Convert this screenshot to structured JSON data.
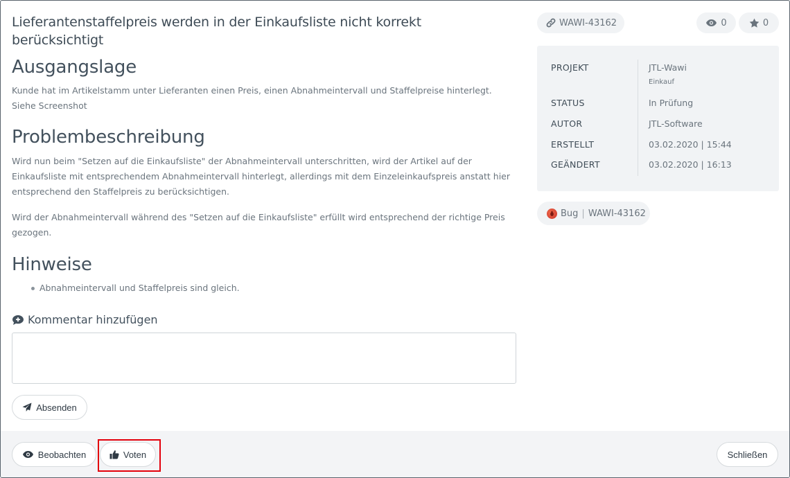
{
  "issue": {
    "title": "Lieferantenstaffelpreis werden in der Einkaufsliste nicht korrekt berücksichtigt",
    "sections": {
      "ausgangslage": {
        "heading": "Ausgangslage",
        "text": "Kunde hat im Artikelstamm unter Lieferanten einen Preis, einen Abnahmeintervall und Staffelpreise hinterlegt. Siehe Screenshot"
      },
      "problembeschreibung": {
        "heading": "Problembeschreibung",
        "paragraphs": [
          "Wird nun beim \"Setzen auf die Einkaufsliste\" der Abnahmeintervall unterschritten, wird der Artikel auf der Einkaufsliste mit entsprechendem Abnahmeintervall hinterlegt, allerdings mit dem Einzeleinkaufspreis anstatt hier entsprechend den Staffelpreis zu berücksichtigen.",
          "Wird der Abnahmeintervall während des \"Setzen auf die Einkaufsliste\" erfüllt wird entsprechend der richtige Preis gezogen."
        ]
      },
      "hinweise": {
        "heading": "Hinweise",
        "items": [
          "Abnahmeintervall und Staffelpreis sind gleich."
        ]
      }
    }
  },
  "comment": {
    "heading": "Kommentar hinzufügen",
    "value": "",
    "submit_label": "Absenden"
  },
  "sidebar": {
    "issue_id": "WAWI-43162",
    "views": "0",
    "stars": "0",
    "info": {
      "project_label": "PROJEKT",
      "project_value": "JTL-Wawi",
      "project_sub": "Einkauf",
      "status_label": "STATUS",
      "status_value": "In Prüfung",
      "author_label": "AUTOR",
      "author_value": "JTL-Software",
      "created_label": "ERSTELLT",
      "created_value": "03.02.2020 | 15:44",
      "changed_label": "GEÄNDERT",
      "changed_value": "03.02.2020 | 16:13"
    },
    "tag": {
      "type": "Bug",
      "separator": "|",
      "id": "WAWI-43162"
    }
  },
  "footer": {
    "watch_label": "Beobachten",
    "vote_label": "Voten",
    "close_label": "Schließen"
  },
  "colors": {
    "highlight": "#e3000b",
    "panel_bg": "#f1f3f5",
    "bug": "#d9412f"
  },
  "icons": {
    "link": "link-icon",
    "eye": "eye-icon",
    "star": "star-icon",
    "comment": "comment-plus-icon",
    "send": "paper-plane-icon",
    "thumbs_up": "thumbs-up-icon",
    "bug": "bug-icon"
  }
}
